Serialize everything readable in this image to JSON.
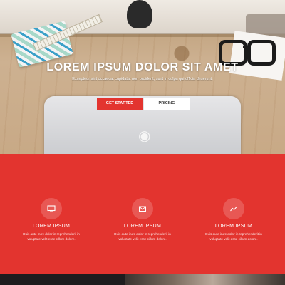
{
  "hero": {
    "title": "LOREM IPSUM DOLOR SIT AMET",
    "subtitle": "Excepteur sint occaecat cupidatat non proident, sunt in culpa qui officia deserunt.",
    "primary_button": "GET STARTED",
    "secondary_button": "PRICING"
  },
  "features": [
    {
      "icon": "monitor-icon",
      "title": "LOREM IPSUM",
      "desc_line1": "Duis aute irure dolor in reprehenderit in",
      "desc_line2": "voluptate velit esse cillum dolore."
    },
    {
      "icon": "envelope-icon",
      "title": "LOREM IPSUM",
      "desc_line1": "Duis aute irure dolor in reprehenderit in",
      "desc_line2": "voluptate velit esse cillum dolore."
    },
    {
      "icon": "line-chart-icon",
      "title": "LOREM IPSUM",
      "desc_line1": "Duis aute irure dolor in reprehenderit in",
      "desc_line2": "voluptate velit esse cillum dolore."
    }
  ],
  "colors": {
    "accent": "#e3342f",
    "dark": "#1e1c1e",
    "white": "#ffffff"
  }
}
